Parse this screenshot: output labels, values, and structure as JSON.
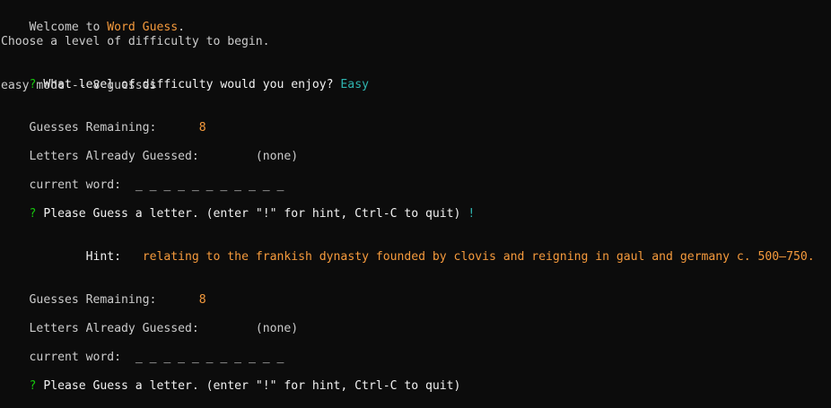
{
  "welcome": {
    "prefix": "Welcome to ",
    "game_name": "Word Guess",
    "suffix": "."
  },
  "choose_level": "Choose a level of difficulty to begin.",
  "difficulty_prompt": {
    "marker": "?",
    "question": " What level of difficulty would you enjoy? ",
    "answer": "Easy"
  },
  "mode_message": "easy mode -- 8 guesses",
  "round1": {
    "guesses_remaining_label": "Guesses Remaining:",
    "guesses_remaining_value": "8",
    "letters_guessed_label": "Letters Already Guessed:",
    "letters_guessed_value": "(none)",
    "current_word_label": "current word:",
    "current_word_value": "_ _ _ _ _ _ _ _ _ _ _",
    "prompt_marker": "?",
    "prompt_text": " Please Guess a letter. (enter \"!\" for hint, Ctrl-C to quit) ",
    "prompt_answer": "!"
  },
  "hint": {
    "label": "Hint:",
    "text": "relating to the frankish dynasty founded by clovis and reigning in gaul and germany c. 500–750."
  },
  "round2": {
    "guesses_remaining_label": "Guesses Remaining:",
    "guesses_remaining_value": "8",
    "letters_guessed_label": "Letters Already Guessed:",
    "letters_guessed_value": "(none)",
    "current_word_label": "current word:",
    "current_word_value": "_ _ _ _ _ _ _ _ _ _ _",
    "prompt_marker": "?",
    "prompt_text": " Please Guess a letter. (enter \"!\" for hint, Ctrl-C to quit)"
  },
  "colors": {
    "background": "#0c0c0c",
    "text": "#cccccc",
    "accent_orange": "#f59a3c",
    "prompt_green": "#16c60c",
    "answer_teal": "#2fb5b0"
  }
}
